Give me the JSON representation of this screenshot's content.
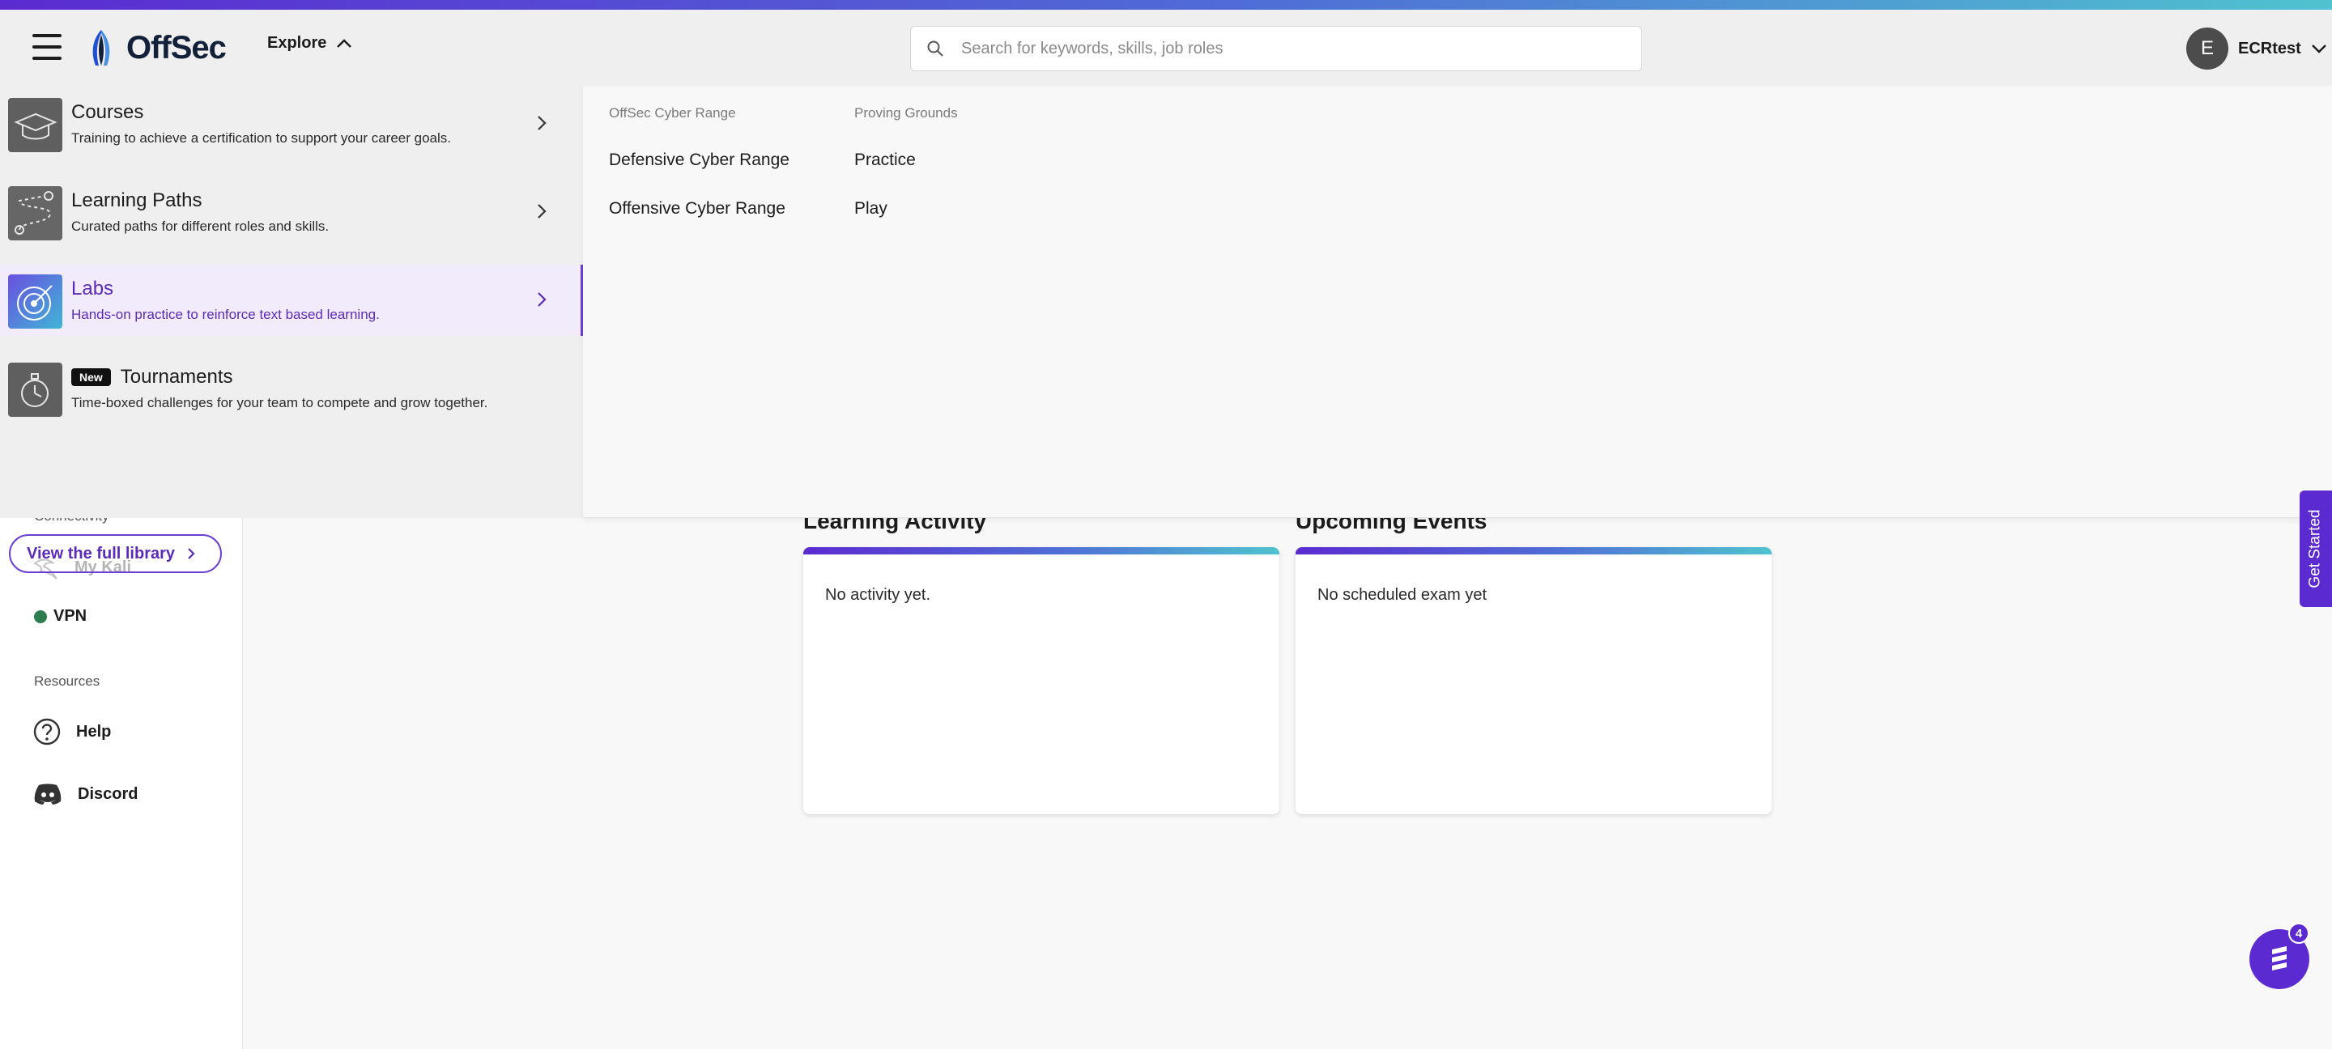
{
  "header": {
    "brand": "OffSec",
    "explore_label": "Explore",
    "search_placeholder": "Search for keywords, skills, job roles",
    "search_value": "",
    "user": {
      "initial": "E",
      "name": "ECRtest"
    }
  },
  "explore_menu": {
    "items": [
      {
        "title": "Courses",
        "description": "Training to achieve a certification to support your career goals.",
        "icon": "courses-thumbnail",
        "active": false
      },
      {
        "title": "Learning Paths",
        "description": "Curated paths for different roles and skills.",
        "icon": "learning-paths-thumbnail",
        "active": false
      },
      {
        "title": "Labs",
        "description": "Hands-on practice to reinforce text based learning.",
        "icon": "labs-thumbnail",
        "active": true
      },
      {
        "title": "Tournaments",
        "badge": "New",
        "description": "Time-boxed challenges for your team to compete and grow together.",
        "icon": "tournaments-thumbnail",
        "active": false
      }
    ],
    "view_library_label": "View the full library",
    "submenu": {
      "columns": [
        {
          "heading": "OffSec Cyber Range",
          "links": [
            "Defensive Cyber Range",
            "Offensive Cyber Range"
          ]
        },
        {
          "heading": "Proving Grounds",
          "links": [
            "Practice",
            "Play"
          ]
        }
      ]
    }
  },
  "sidebar": {
    "connectivity_label": "Connectivity",
    "my_kali_label": "My Kali",
    "vpn_label": "VPN",
    "resources_label": "Resources",
    "help_label": "Help",
    "discord_label": "Discord"
  },
  "main": {
    "learning_activity": {
      "title": "Learning Activity",
      "empty_text": "No activity yet."
    },
    "upcoming_events": {
      "title": "Upcoming Events",
      "empty_text": "No scheduled exam yet"
    }
  },
  "get_started_label": "Get Started",
  "chat": {
    "notification_count": "4"
  },
  "colors": {
    "accent": "#5b2bd1",
    "gradient_end": "#4fc3cf",
    "vpn_status": "#2e7d4f"
  }
}
